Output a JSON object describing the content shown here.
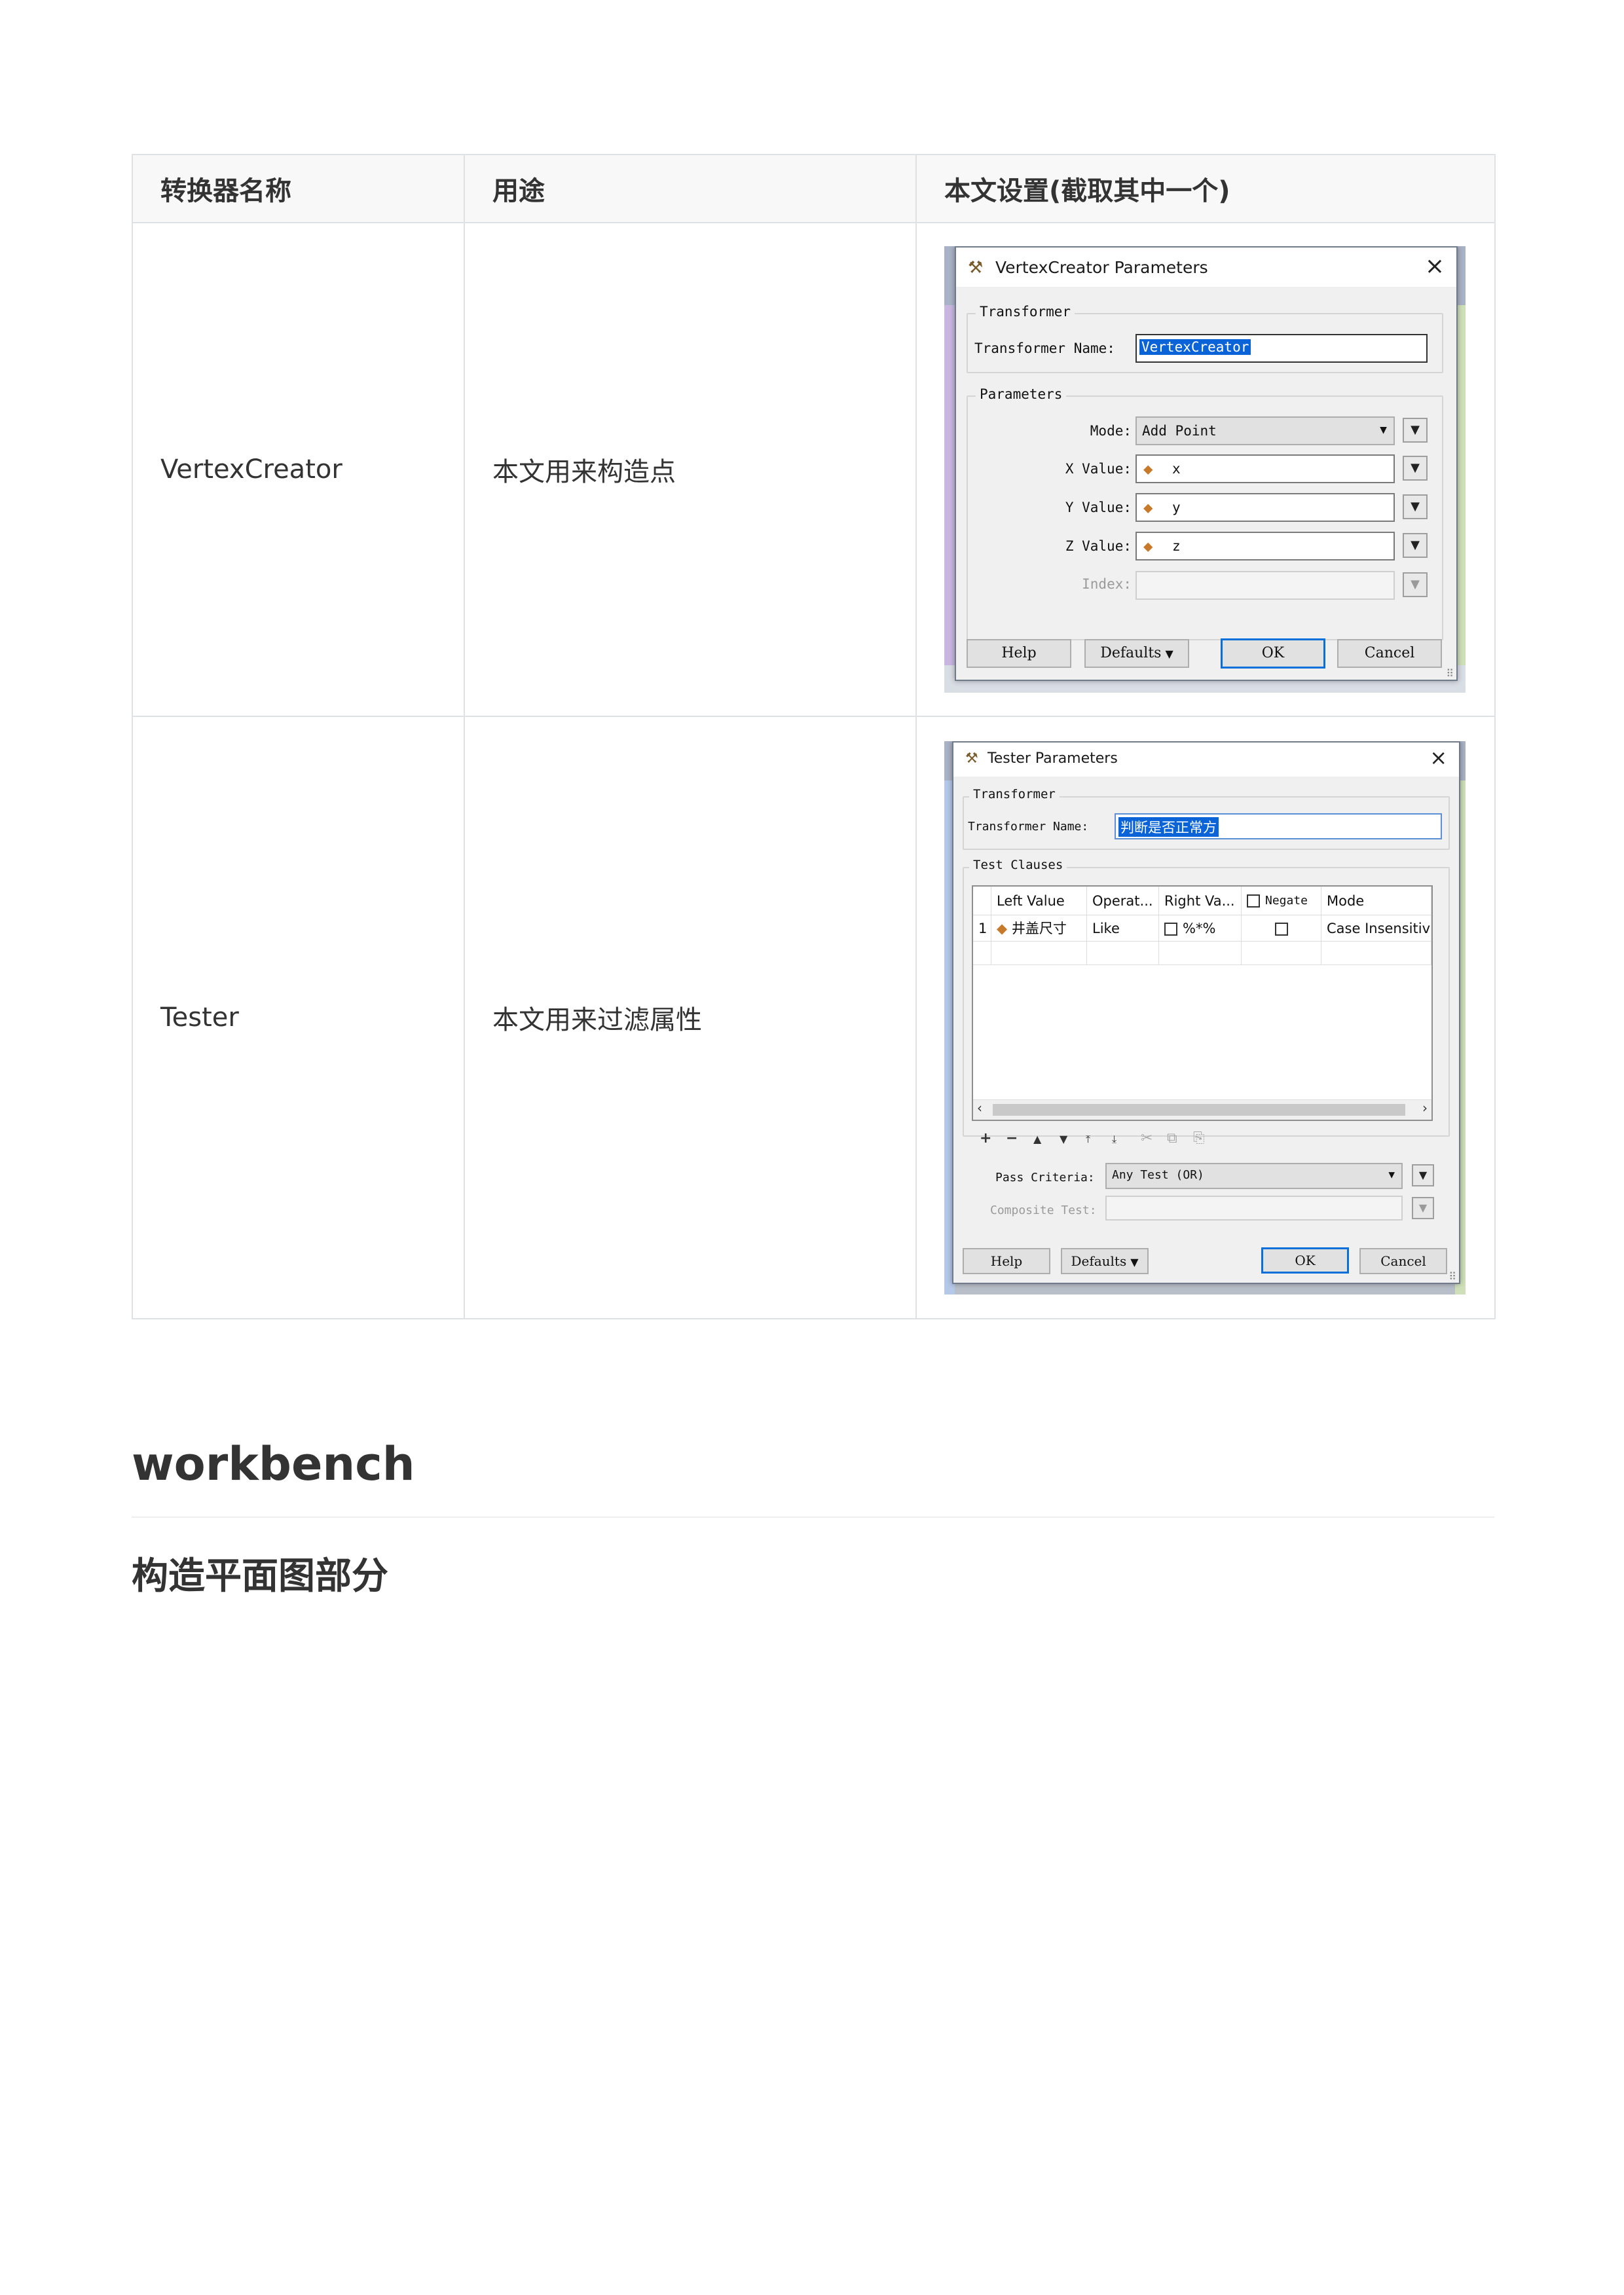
{
  "table": {
    "headers": [
      "转换器名称",
      "用途",
      "本文设置(截取其中一个)"
    ],
    "rows": [
      {
        "name": "VertexCreator",
        "purpose": "本文用来构造点"
      },
      {
        "name": "Tester",
        "purpose": "本文用来过滤属性"
      }
    ]
  },
  "vertex_dialog": {
    "title": "VertexCreator Parameters",
    "transformer_group": "Transformer",
    "transformer_name_label": "Transformer Name:",
    "transformer_name_value": "VertexCreator",
    "parameters_group": "Parameters",
    "mode_label": "Mode:",
    "mode_value": "Add Point",
    "x_label": "X Value:",
    "x_value": "x",
    "y_label": "Y Value:",
    "y_value": "y",
    "z_label": "Z Value:",
    "z_value": "z",
    "index_label": "Index:",
    "buttons": {
      "help": "Help",
      "defaults": "Defaults",
      "ok": "OK",
      "cancel": "Cancel"
    }
  },
  "tester_dialog": {
    "title": "Tester Parameters",
    "transformer_group": "Transformer",
    "transformer_name_label": "Transformer Name:",
    "transformer_name_value": "判断是否正常方",
    "clauses_group": "Test Clauses",
    "columns": [
      "Left Value",
      "Operat...",
      "Right Va...",
      "Negate",
      "Mode"
    ],
    "row": {
      "index": "1",
      "left": "井盖尺寸",
      "op": "Like",
      "right": "%*%",
      "mode": "Case Insensitive"
    },
    "toolbar_icons": [
      "add-icon",
      "remove-icon",
      "move-up-icon",
      "move-down-icon",
      "move-top-icon",
      "move-bottom-icon",
      "cut-icon",
      "copy-icon",
      "paste-icon"
    ],
    "pass_criteria_label": "Pass Criteria:",
    "pass_criteria_value": "Any Test (OR)",
    "composite_label": "Composite Test:",
    "buttons": {
      "help": "Help",
      "defaults": "Defaults",
      "ok": "OK",
      "cancel": "Cancel"
    }
  },
  "headings": {
    "h1": "workbench",
    "h2": "构造平面图部分"
  }
}
